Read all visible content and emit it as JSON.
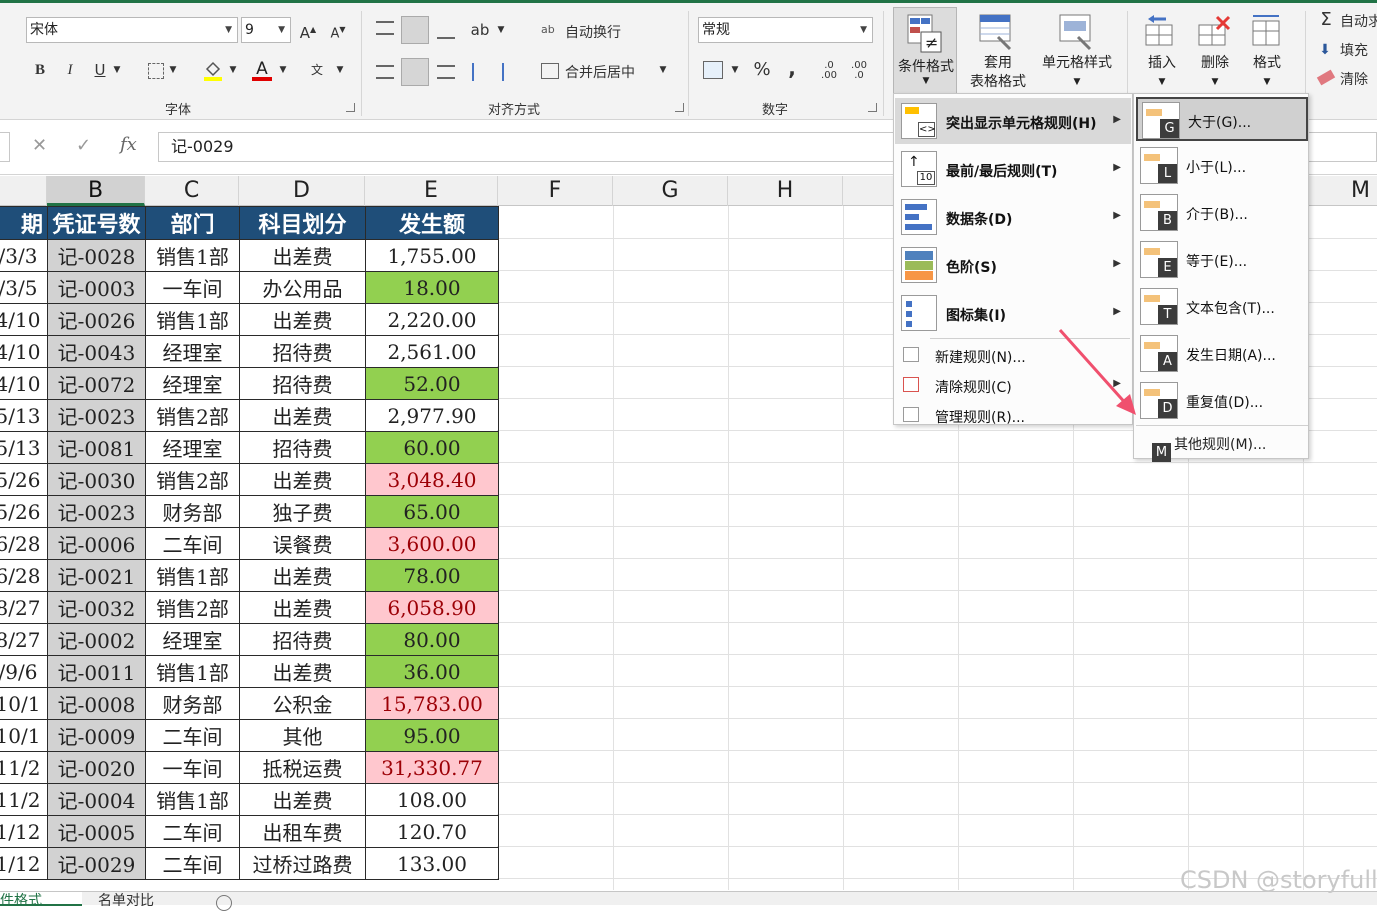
{
  "ribbon": {
    "font_group_label": "字体",
    "font_name": "宋体",
    "font_size": "9",
    "bold": "B",
    "italic": "I",
    "underline": "U",
    "align_group_label": "对齐方式",
    "wrap_text": "自动换行",
    "merge_center": "合并后居中",
    "number_group_label": "数字",
    "number_format": "常规",
    "percent": "%",
    "comma": ",",
    "cond_format": "条件格式",
    "table_format_1": "套用",
    "table_format_2": "表格格式",
    "cell_styles": "单元格样式",
    "insert": "插入",
    "delete": "删除",
    "format": "格式",
    "autosum": "自动求",
    "fill": "填充",
    "clear": "清除"
  },
  "formula_bar": {
    "cancel": "✕",
    "confirm": "✓",
    "fx": "fx",
    "content": "记-0029"
  },
  "columns": [
    "B",
    "C",
    "D",
    "E",
    "F",
    "G",
    "H",
    "M"
  ],
  "table": {
    "headers": [
      "期",
      "凭证号数",
      "部门",
      "科目划分",
      "发生额"
    ],
    "rows": [
      {
        "date": "/3/3",
        "voucher": "记-0028",
        "dept": "销售1部",
        "subject": "出差费",
        "amount": "1,755.00",
        "style": "none"
      },
      {
        "date": "/3/5",
        "voucher": "记-0003",
        "dept": "一车间",
        "subject": "办公用品",
        "amount": "18.00",
        "style": "green"
      },
      {
        "date": "4/10",
        "voucher": "记-0026",
        "dept": "销售1部",
        "subject": "出差费",
        "amount": "2,220.00",
        "style": "none"
      },
      {
        "date": "4/10",
        "voucher": "记-0043",
        "dept": "经理室",
        "subject": "招待费",
        "amount": "2,561.00",
        "style": "none"
      },
      {
        "date": "4/10",
        "voucher": "记-0072",
        "dept": "经理室",
        "subject": "招待费",
        "amount": "52.00",
        "style": "green"
      },
      {
        "date": "5/13",
        "voucher": "记-0023",
        "dept": "销售2部",
        "subject": "出差费",
        "amount": "2,977.90",
        "style": "none"
      },
      {
        "date": "5/13",
        "voucher": "记-0081",
        "dept": "经理室",
        "subject": "招待费",
        "amount": "60.00",
        "style": "green"
      },
      {
        "date": "5/26",
        "voucher": "记-0030",
        "dept": "销售2部",
        "subject": "出差费",
        "amount": "3,048.40",
        "style": "pink"
      },
      {
        "date": "5/26",
        "voucher": "记-0023",
        "dept": "财务部",
        "subject": "独子费",
        "amount": "65.00",
        "style": "green"
      },
      {
        "date": "6/28",
        "voucher": "记-0006",
        "dept": "二车间",
        "subject": "误餐费",
        "amount": "3,600.00",
        "style": "pink"
      },
      {
        "date": "6/28",
        "voucher": "记-0021",
        "dept": "销售1部",
        "subject": "出差费",
        "amount": "78.00",
        "style": "green"
      },
      {
        "date": "8/27",
        "voucher": "记-0032",
        "dept": "销售2部",
        "subject": "出差费",
        "amount": "6,058.90",
        "style": "pink"
      },
      {
        "date": "8/27",
        "voucher": "记-0002",
        "dept": "经理室",
        "subject": "招待费",
        "amount": "80.00",
        "style": "green"
      },
      {
        "date": "/9/6",
        "voucher": "记-0011",
        "dept": "销售1部",
        "subject": "出差费",
        "amount": "36.00",
        "style": "green"
      },
      {
        "date": "10/1",
        "voucher": "记-0008",
        "dept": "财务部",
        "subject": "公积金",
        "amount": "15,783.00",
        "style": "pink"
      },
      {
        "date": "10/1",
        "voucher": "记-0009",
        "dept": "二车间",
        "subject": "其他",
        "amount": "95.00",
        "style": "green"
      },
      {
        "date": "11/2",
        "voucher": "记-0020",
        "dept": "一车间",
        "subject": "抵税运费",
        "amount": "31,330.77",
        "style": "pink"
      },
      {
        "date": "11/2",
        "voucher": "记-0004",
        "dept": "销售1部",
        "subject": "出差费",
        "amount": "108.00",
        "style": "none"
      },
      {
        "date": "1/12",
        "voucher": "记-0005",
        "dept": "二车间",
        "subject": "出租车费",
        "amount": "120.70",
        "style": "none"
      },
      {
        "date": "1/12",
        "voucher": "记-0029",
        "dept": "二车间",
        "subject": "过桥过路费",
        "amount": "133.00",
        "style": "none"
      }
    ]
  },
  "menu": {
    "items": [
      {
        "label": "突出显示单元格规则(H)",
        "icon": "highlight-rules-icon"
      },
      {
        "label": "最前/最后规则(T)",
        "icon": "top-bottom-icon",
        "badge": "10"
      },
      {
        "label": "数据条(D)",
        "icon": "data-bars-icon"
      },
      {
        "label": "色阶(S)",
        "icon": "color-scales-icon"
      },
      {
        "label": "图标集(I)",
        "icon": "icon-sets-icon"
      }
    ],
    "small_items": [
      {
        "label": "新建规则(N)...",
        "icon": "new-rule-icon"
      },
      {
        "label": "清除规则(C)",
        "icon": "clear-rules-icon"
      },
      {
        "label": "管理规则(R)...",
        "icon": "manage-rules-icon"
      }
    ]
  },
  "submenu": {
    "items": [
      {
        "label": "大于(G)...",
        "key": "G"
      },
      {
        "label": "小于(L)...",
        "key": "L"
      },
      {
        "label": "介于(B)...",
        "key": "B"
      },
      {
        "label": "等于(E)...",
        "key": "E"
      },
      {
        "label": "文本包含(T)...",
        "key": "T"
      },
      {
        "label": "发生日期(A)...",
        "key": "A"
      },
      {
        "label": "重复值(D)...",
        "key": "D"
      }
    ],
    "other_label": "其他规则(M)...",
    "other_key": "M"
  },
  "sheet_tabs": [
    "条件格式",
    "名单对比"
  ],
  "colors": {
    "header_fill": "#1f4e79",
    "green_fill": "#92d050",
    "pink_fill": "#ffc7ce",
    "pink_text": "#9c0006",
    "annotation_arrow": "#f0506e"
  },
  "watermark": "CSDN @storyfull"
}
